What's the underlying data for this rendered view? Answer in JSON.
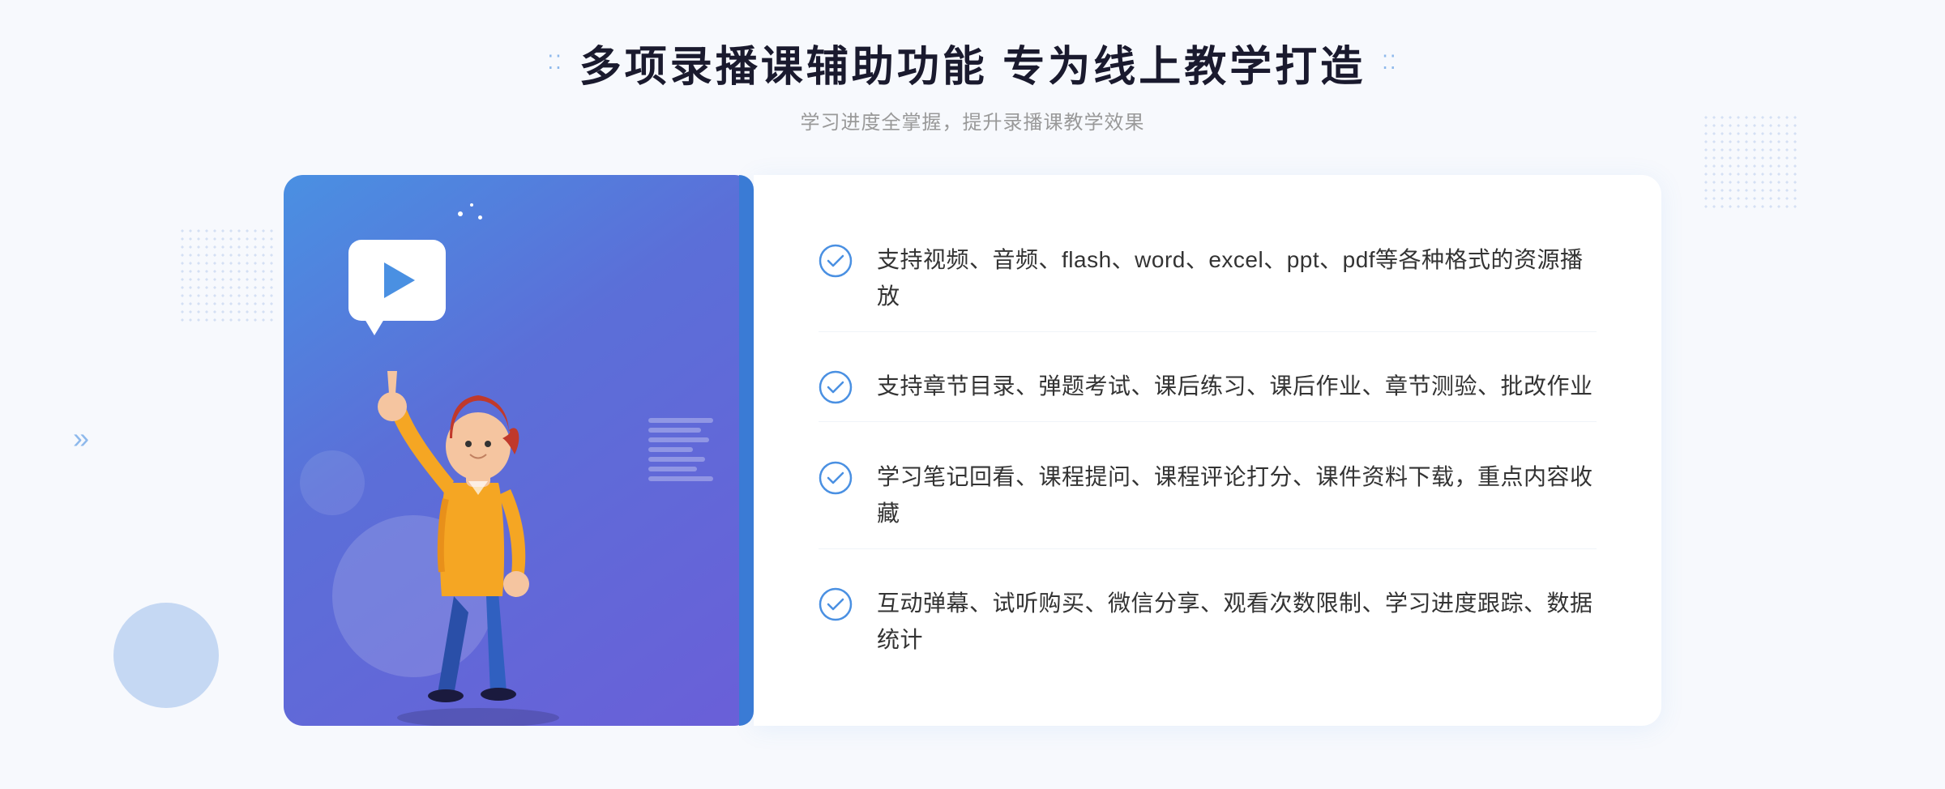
{
  "header": {
    "title": "多项录播课辅助功能 专为线上教学打造",
    "subtitle": "学习进度全掌握，提升录播课教学效果",
    "title_dots_left": "⁚⁚",
    "title_dots_right": "⁚⁚"
  },
  "features": [
    {
      "id": 1,
      "text": "支持视频、音频、flash、word、excel、ppt、pdf等各种格式的资源播放"
    },
    {
      "id": 2,
      "text": "支持章节目录、弹题考试、课后练习、课后作业、章节测验、批改作业"
    },
    {
      "id": 3,
      "text": "学习笔记回看、课程提问、课程评论打分、课件资料下载，重点内容收藏"
    },
    {
      "id": 4,
      "text": "互动弹幕、试听购买、微信分享、观看次数限制、学习进度跟踪、数据统计"
    }
  ],
  "chevron": "»",
  "colors": {
    "primary": "#4a90e2",
    "accent": "#5b6fd8",
    "light_blue": "#a8c4f0",
    "text_dark": "#1a1a2e",
    "text_gray": "#999999",
    "text_body": "#333333",
    "white": "#ffffff",
    "card_bg": "#ffffff",
    "page_bg": "#f7f9fd"
  }
}
